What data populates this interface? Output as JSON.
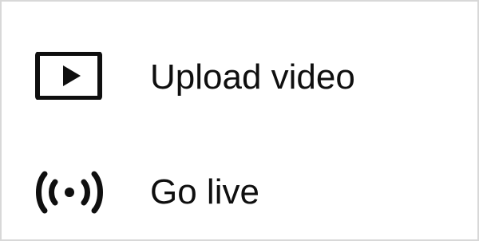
{
  "menu": {
    "items": [
      {
        "label": "Upload video",
        "icon": "upload-video-icon"
      },
      {
        "label": "Go live",
        "icon": "go-live-icon"
      }
    ]
  },
  "colors": {
    "text": "#0f0f0f",
    "icon": "#0f0f0f",
    "border": "#d8d8d8",
    "background": "#ffffff"
  }
}
